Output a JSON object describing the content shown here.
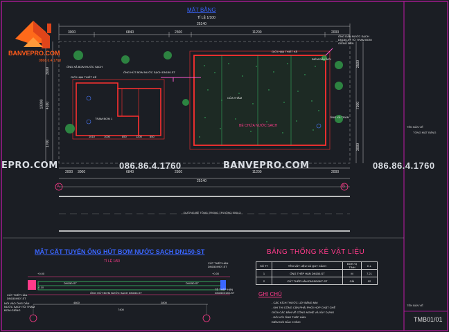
{
  "brand": {
    "name": "BANVEPRO.COM",
    "phone": "0868.6.4.1760",
    "logo_color": "#ff5a1a"
  },
  "watermarks": {
    "left": "EPRO.COM",
    "phone_left": "086.86.4.1760",
    "center": "BANVEPRO.COM",
    "phone_right": "086.86.4.1760"
  },
  "plan": {
    "title": "MẶT BẰNG",
    "scale": "TỈ LỆ 1/100",
    "dim_total_top": "25140",
    "dims_top": [
      "3000",
      "6840",
      "2300",
      "11200",
      "2000"
    ],
    "dims_bottom": [
      "2000",
      "3000",
      "6840",
      "2300",
      "11200",
      "2000"
    ],
    "dim_total_bottom": "25140",
    "dims_inner": [
      "1010",
      "1000",
      "850",
      "1200",
      "850"
    ],
    "left_dims": [
      "3000",
      "1700",
      "4160",
      "10300"
    ],
    "right_dims": [
      "2500",
      "3000",
      "7300"
    ],
    "inner_dims": [
      "4800",
      "3300",
      "3300",
      "3300",
      "3300",
      "3300"
    ],
    "axis_a": "A",
    "axis_b": "B",
    "road_label": "ĐƯỜNG BÊ TÔNG TRONG TRƯỜNG 500LO",
    "tram_bom_label": "TRẠM BƠM 1",
    "be_label": "BỂ CHỨA NƯỚC SẠCH",
    "annotations": [
      "ỐNG XẢ BƠM NƯỚC SẠCH",
      "GIỚI HẠN THIẾT KẾ",
      "ỐNG HÚT BƠM NƯỚC SẠCH DN150-ST",
      "GIỚI HẠN THIẾT KẾ",
      "ĐIỂM ĐẦU NỐI",
      "ỐNG DẪN NƯỚC SẠCH DN150-ST TỪ TRẠM BƠM GIẾNG ĐẾN",
      "CỬA THĂM",
      "ỐNG XẢ TRÀN"
    ]
  },
  "section": {
    "title": "MẶT CẮT TUYẾN ỐNG HÚT BƠM NƯỚC SẠCH DN150-ST",
    "scale": "TỈ LỆ 1/50",
    "labels": [
      "CÚT THÉP HÀN DN150X90°-ST",
      "NỐI VÀO ỐNG DẪN NƯỚC SẠCH TỪ TRẠM BƠM GIẾNG",
      "CÚT THÉP HÀN DN150X90°-ST",
      "TÊ THÉP HÀN DN150X150-ST",
      "ỐNG HÚT BƠM NƯỚC SẠCH DN150-ST"
    ],
    "dims": [
      "4800",
      "2800",
      "7400"
    ],
    "levels": [
      "+0.00",
      "-0.10",
      "+0.00"
    ],
    "markers": [
      "DN150-ST",
      "DN150-ST"
    ]
  },
  "materials": {
    "title": "BẢNG THỐNG KÊ VẬT LIỆU",
    "headers": [
      "SỐ TT",
      "TÊN VẬT LIỆU VÀ QUY CÁCH",
      "ĐƠN VỊ TÍNH",
      "K.L"
    ],
    "rows": [
      [
        "1",
        "ỐNG THÉP HÀN DN150-ST",
        "M",
        "7.21"
      ],
      [
        "2",
        "CÚT THÉP HÀN DN150X90°-ST",
        "CÁI",
        "02"
      ]
    ]
  },
  "notes": {
    "title": "GHI CHÚ",
    "items": [
      "- CÁC KÍCH THƯỚC LẤY BẰNG MM",
      "- KHI THI CÔNG CẦN PHẢI PHỐI HỢP CHẶT CHẼ",
      "  GIỮA CÁC BẢN VẼ CÔNG NGHỆ VÀ XÂY DỰNG",
      "- ĐỐI VỚI ỐNG THÉP HÀN",
      "  ĐIỂM NỐI ĐẦU CHÍNH"
    ]
  },
  "title_block": {
    "label_top": "TÊN BẢN VẼ",
    "label_top2": "TỔNG MẶT BẰNG",
    "label_bottom": "TÊN BẢN VẼ",
    "code": "TMB01/01"
  }
}
